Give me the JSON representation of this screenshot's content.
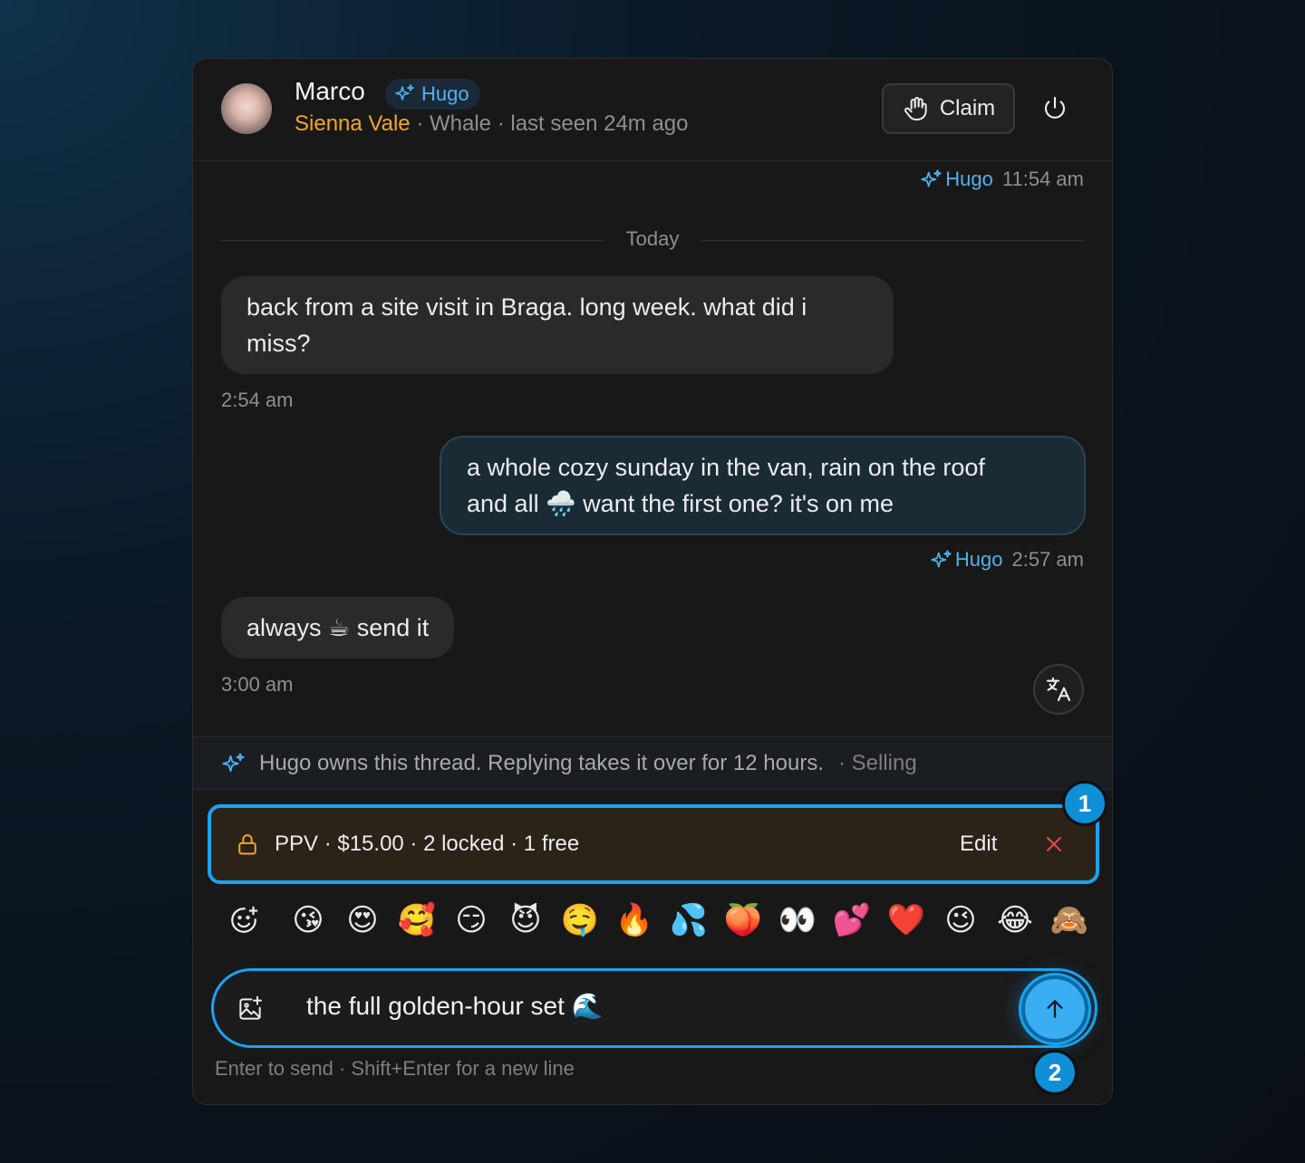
{
  "header": {
    "contact_name": "Marco",
    "agent_badge": "Hugo",
    "fan_name": "Sienna Vale",
    "tier": "Whale",
    "last_seen": "last seen 24m ago",
    "claim_label": "Claim"
  },
  "thread": {
    "top_meta": {
      "agent": "Hugo",
      "time": "11:54 am"
    },
    "divider_label": "Today",
    "messages": [
      {
        "direction": "in",
        "text": "back from a site visit in Braga. long week. what did i miss?",
        "time": "2:54 am"
      },
      {
        "direction": "out",
        "line1": "a whole cozy sunday in the van, rain on the roof",
        "line2": "and all 🌧️ want the first one? it's on me",
        "agent": "Hugo",
        "time": "2:57 am"
      },
      {
        "direction": "in",
        "text": "always ☕ send it",
        "time": "3:00 am"
      }
    ]
  },
  "owner_notice": {
    "text": "Hugo owns this thread. Replying takes it over for 12 hours.",
    "mode": "· Selling"
  },
  "ppv": {
    "summary": "PPV · $15.00 · 2 locked · 1 free",
    "edit_label": "Edit"
  },
  "emojis": [
    "😘",
    "😍",
    "🥰",
    "😏",
    "😈",
    "🤤",
    "🔥",
    "💦",
    "🍑",
    "👀",
    "💕",
    "❤️",
    "😉",
    "😂",
    "🙈"
  ],
  "composer": {
    "value": "the full golden-hour set 🌊",
    "hint": "Enter to send · Shift+Enter for a new line"
  },
  "callouts": [
    "1",
    "2"
  ],
  "colors": {
    "accent": "#19a3f0",
    "agent": "#4fb2ef",
    "fan": "#f5a524",
    "danger": "#e5484d"
  },
  "icons": [
    "sparkle-icon",
    "hand-icon",
    "power-icon",
    "translate-icon",
    "lock-icon",
    "close-icon",
    "emoji-add-icon",
    "image-add-icon",
    "arrow-up-icon"
  ]
}
